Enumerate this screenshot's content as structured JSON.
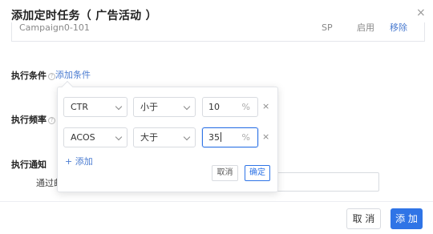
{
  "dialog": {
    "title": "添加定时任务（ 广告活动 ）",
    "close_label": "×"
  },
  "table": {
    "row": {
      "name": "Campaign0-101",
      "mid": "SP",
      "status": "启用",
      "remove": "移除"
    }
  },
  "form": {
    "conditions_label": "执行条件",
    "help_icon": "?",
    "add_condition_link": "添加条件",
    "frequency_label": "执行频率",
    "notify_label": "执行通知",
    "email_label": "通过邮"
  },
  "popover": {
    "rows": [
      {
        "metric": "CTR",
        "operator": "小于",
        "value": "10",
        "unit": "%",
        "remove": "×"
      },
      {
        "metric": "ACOS",
        "operator": "大于",
        "value": "35",
        "unit": "%",
        "remove": "×"
      }
    ],
    "add_link": "+ 添加",
    "cancel_label": "取消",
    "confirm_label": "确定"
  },
  "footer": {
    "cancel_label": "取 消",
    "add_label": "添 加"
  }
}
